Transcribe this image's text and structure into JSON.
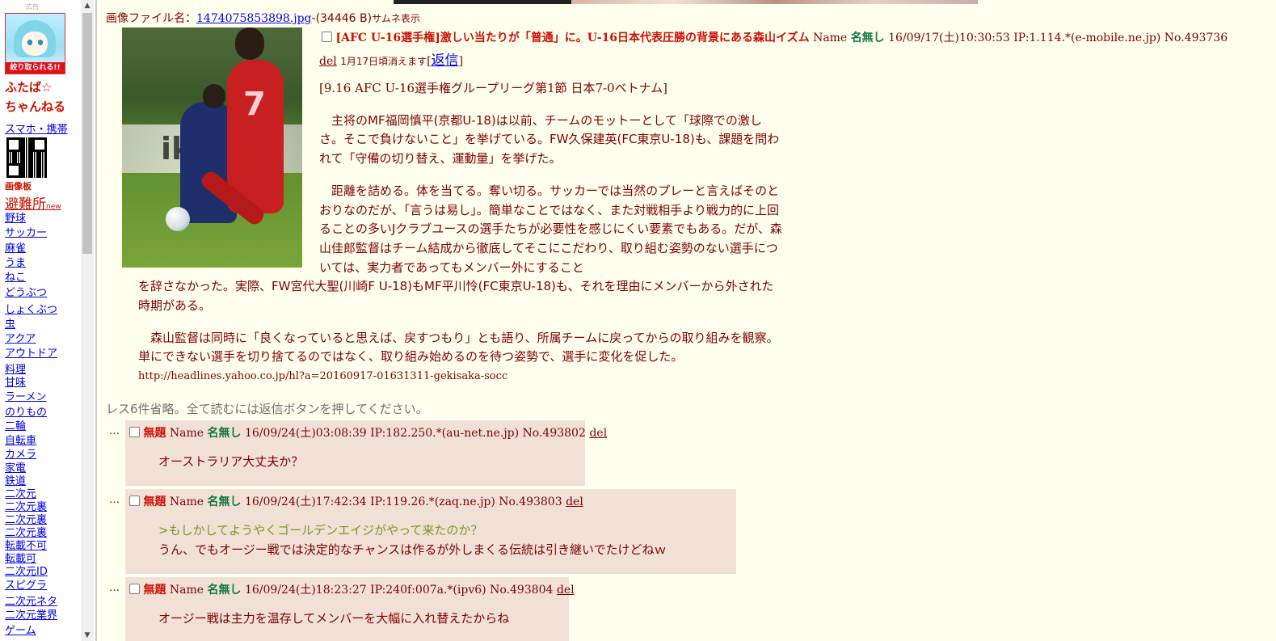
{
  "sidebar": {
    "ad_label": "広告",
    "mascot_caption": "絞り取られる!!",
    "site_title_line1": "ふたば☆",
    "site_title_line2": "ちゃんねる",
    "mobile_link": "スマホ・携帯",
    "imageboard_label": "画像板",
    "refuge_label": "避難所",
    "refuge_new": "new",
    "nav_items": [
      "野球",
      "サッカー",
      "麻雀",
      "うま",
      "ねこ",
      "どうぶつ",
      "しょくぶつ",
      "虫",
      "アクア",
      "アウトドア",
      "料理",
      "甘味",
      "ラーメン",
      "のりもの",
      "二輪",
      "自転車",
      "カメラ",
      "家電",
      "鉄道",
      "二次元",
      "二次元裏",
      "二次元裏",
      "二次元裏",
      "転載不可",
      "転載可",
      "二次元ID",
      "スピグラ",
      "二次元ネタ",
      "二次元業界",
      "ゲーム"
    ],
    "scroll_up": "▲",
    "scroll_down": "▼"
  },
  "op": {
    "file_label": "画像ファイル名：",
    "file_name": "1474075853898.jpg",
    "file_size": "-(34446 B)",
    "thumb_label": "サムネ表示",
    "image_text": "ik",
    "image_number": "7",
    "subject": "[AFC U-16選手権]激しい当たりが「普通」に。U-16日本代表圧勝の背景にある森山イズム",
    "name_label": "Name",
    "poster_name": "名無し",
    "datetime": "16/09/17(土)10:30:53",
    "ip": "IP:1.114.*(e-mobile.ne.jp)",
    "post_no": "No.493736",
    "del_label": "del",
    "expiry": "1月17日頃消えます",
    "reply_link": "返信",
    "bracket_open": "[",
    "bracket_close": "]",
    "para1": "[9.16 AFC U-16選手権グループリーグ第1節 日本7-0ベトナム]",
    "para2": "　主将のMF福岡慎平(京都U-18)は以前、チームのモットーとして「球際での激しさ。そこで負けないこと」を挙げている。FW久保建英(FC東京U-18)も、課題を問われて「守備の切り替え、運動量」を挙げた。",
    "para3a": "　距離を詰める。体を当てる。奪い切る。サッカーでは当然のプレーと言えばそのとおりなのだが、「言うは易し」。簡単なことではなく、また対戦相手より戦力的に上回ることの多いJクラブユースの選手たちが必要性を感じにくい要素でもある。だが、森山佳郎監督はチーム結成から徹底してそこにこだわり、取り組む姿勢のない選手については、実力者であってもメンバー外にすること",
    "para3b": "を辞さなかった。実際、FW宮代大聖(川崎F U-18)もMF平川怜(FC東京U-18)も、それを理由にメンバーから外された時期がある。",
    "para4": "　森山監督は同時に「良くなっていると思えば、戻すつもり」とも語り、所属チームに戻ってからの取り組みを観察。単にできない選手を切り捨てるのではなく、取り組み始めるのを待つ姿勢で、選手に変化を促した。",
    "url": "http://headlines.yahoo.co.jp/hl?a=20160917-01631311-gekisaka-socc"
  },
  "omitted_notice": "レス6件省略。全て読むには返信ボタンを押してください。",
  "replies": [
    {
      "dots": "…",
      "subject": "無題",
      "name_label": "Name",
      "poster_name": "名無し",
      "datetime": "16/09/24(土)03:08:39",
      "ip": "IP:182.250.*(au-net.ne.jp)",
      "post_no": "No.493802",
      "del_label": "del",
      "line1": "オーストラリア大丈夫か？"
    },
    {
      "dots": "…",
      "subject": "無題",
      "name_label": "Name",
      "poster_name": "名無し",
      "datetime": "16/09/24(土)17:42:34",
      "ip": "IP:119.26.*(zaq.ne.jp)",
      "post_no": "No.493803",
      "del_label": "del",
      "quote": ">もしかしてようやくゴールデンエイジがやって来たのか？",
      "line1": "うん、でもオージー戦では決定的なチャンスは作るが外しまくる伝統は引き継いでたけどねｗ"
    },
    {
      "dots": "…",
      "subject": "無題",
      "name_label": "Name",
      "poster_name": "名無し",
      "datetime": "16/09/24(土)18:23:27",
      "ip": "IP:240f:007a.*(ipv6)",
      "post_no": "No.493804",
      "del_label": "del",
      "line1": "オージー戦は主力を温存してメンバーを大幅に入れ替えたからね"
    }
  ],
  "colors": {
    "page_bg": "#ffffee",
    "reply_bg": "#f0e0d6",
    "subject": "#cc1105",
    "poster": "#117743",
    "quote": "#789922",
    "text": "#800000"
  }
}
